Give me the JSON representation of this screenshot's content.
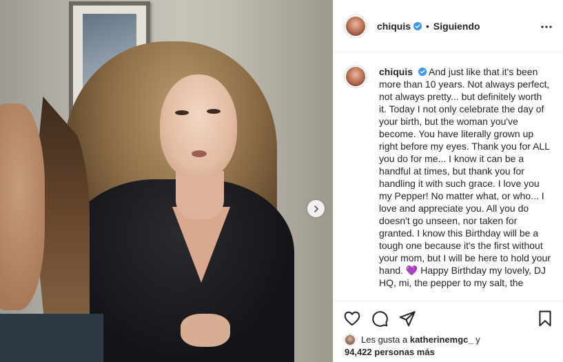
{
  "post": {
    "username": "chiquis",
    "dot": "•",
    "follow_status": "Siguiendo",
    "caption_text": "And just like that it's been more than 10 years. Not always perfect, not always pretty... but definitely worth it. Today I not only celebrate the day of your birth, but the woman you've become. You have literally grown up right before my eyes. Thank you for ALL you do for me... I know it can be a handful at times, but thank you for handling it with such grace. I love you my Pepper! No matter what, or who... I love and appreciate you. All you do doesn't go unseen, nor taken for granted. I know this Birthday will be a tough one because it's the first without your mom, but I will be here to hold your hand. 💜 Happy Birthday my lovely, DJ HQ, mi, the pepper to my salt, the"
  },
  "likes": {
    "prefix": "Les gusta a",
    "liker": "katherinemgc_",
    "conjunction": "y",
    "others": "94,422 personas más"
  },
  "icons": {
    "verified": "verified-badge-icon",
    "more": "more-options-icon",
    "next": "chevron-right-icon",
    "like": "heart-icon",
    "comment": "comment-bubble-icon",
    "share": "paper-plane-icon",
    "save": "bookmark-icon"
  },
  "colors": {
    "verified": "#3897f0",
    "text": "#262626",
    "border": "#efefef"
  }
}
